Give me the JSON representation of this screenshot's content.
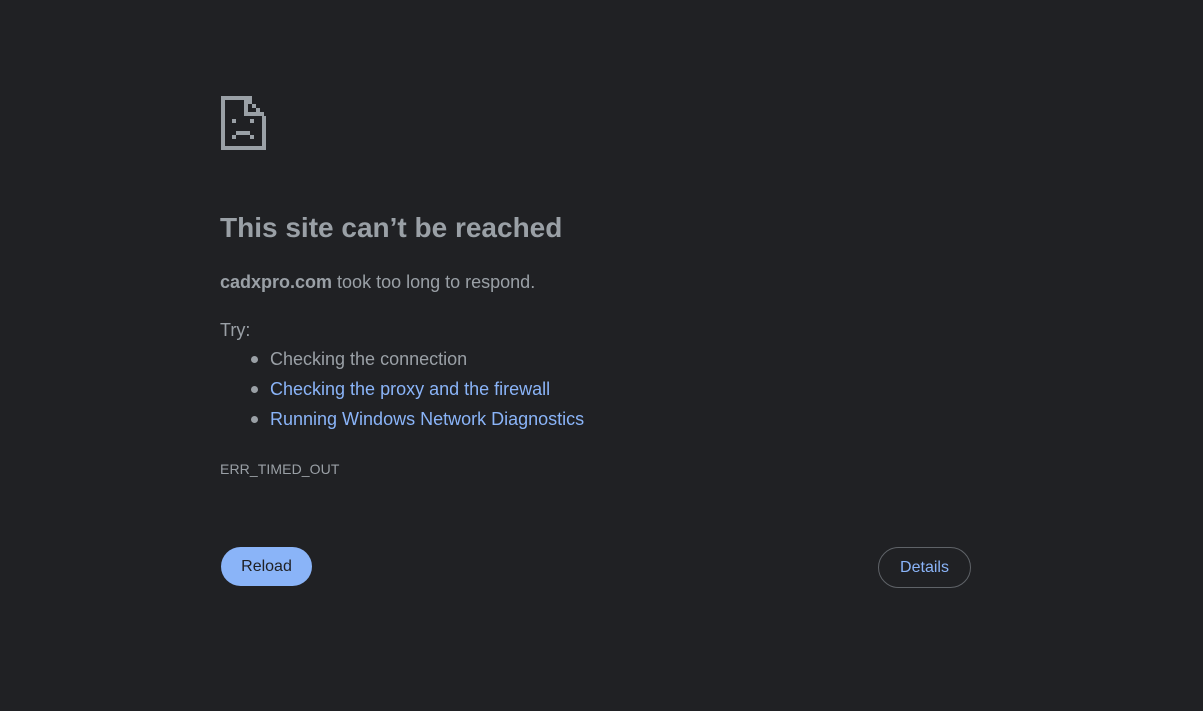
{
  "error": {
    "icon": "sad-page-icon",
    "title": "This site can’t be reached",
    "host": "cadxpro.com",
    "message": " took too long to respond.",
    "try_label": "Try:",
    "suggestions": [
      {
        "text": "Checking the connection",
        "is_link": false
      },
      {
        "text": "Checking the proxy and the firewall",
        "is_link": true
      },
      {
        "text": "Running Windows Network Diagnostics",
        "is_link": true
      }
    ],
    "code": "ERR_TIMED_OUT"
  },
  "buttons": {
    "reload_label": "Reload",
    "details_label": "Details"
  },
  "colors": {
    "background": "#202124",
    "text": "#9aa0a6",
    "link": "#8ab4f8",
    "button_primary": "#8ab4f8",
    "button_border": "#5f6368"
  }
}
